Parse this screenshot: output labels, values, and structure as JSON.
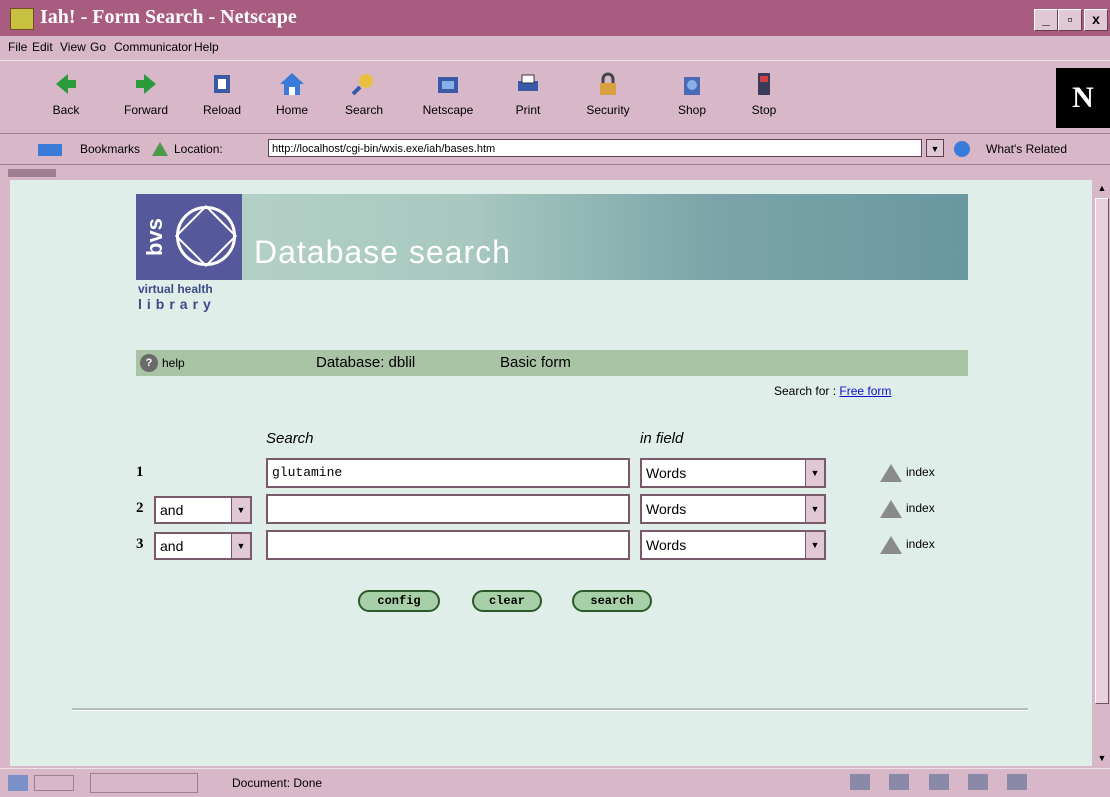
{
  "window": {
    "title": "Iah! - Form Search - Netscape",
    "controls": [
      "_",
      "▫",
      "x"
    ]
  },
  "menu": [
    "File",
    "Edit",
    "View",
    "Go",
    "Communicator",
    "Help"
  ],
  "toolbar": [
    {
      "label": "Back",
      "icon": "back-arrow-icon"
    },
    {
      "label": "Forward",
      "icon": "forward-arrow-icon"
    },
    {
      "label": "Reload",
      "icon": "reload-icon"
    },
    {
      "label": "Home",
      "icon": "home-icon"
    },
    {
      "label": "Search",
      "icon": "search-icon"
    },
    {
      "label": "Netscape",
      "icon": "netscape-icon"
    },
    {
      "label": "Print",
      "icon": "print-icon"
    },
    {
      "label": "Security",
      "icon": "lock-icon"
    },
    {
      "label": "Shop",
      "icon": "shop-icon"
    },
    {
      "label": "Stop",
      "icon": "stop-icon"
    }
  ],
  "netscape_logo": "N",
  "location": {
    "bookmarks_label": "Bookmarks",
    "location_label": "Location:",
    "url": "http://localhost/cgi-bin/wxis.exe/iah/bases.htm",
    "whats_related": "What's Related"
  },
  "banner": {
    "logo_text": "bvs",
    "title": "Database search",
    "vhl_line1": "virtual health",
    "vhl_line2": "library"
  },
  "helpbar": {
    "help": "help",
    "database": "Database: dblil",
    "form": "Basic form"
  },
  "search_for": {
    "label": "Search for :",
    "link": "Free form"
  },
  "form": {
    "search_header": "Search",
    "field_header": "in field",
    "rows": [
      {
        "num": "1",
        "operator": null,
        "value": "glutamine",
        "field": "Words",
        "index": "index"
      },
      {
        "num": "2",
        "operator": "and",
        "value": "",
        "field": "Words",
        "index": "index"
      },
      {
        "num": "3",
        "operator": "and",
        "value": "",
        "field": "Words",
        "index": "index"
      }
    ],
    "buttons": {
      "config": "config",
      "clear": "clear",
      "search": "search"
    }
  },
  "status": {
    "text": "Document: Done"
  },
  "colors": {
    "titlebar": "#a85c80",
    "content_bg": "#dfeee9",
    "helpbar_bg": "#a8c4a4",
    "bvs_blue": "#55589a"
  }
}
